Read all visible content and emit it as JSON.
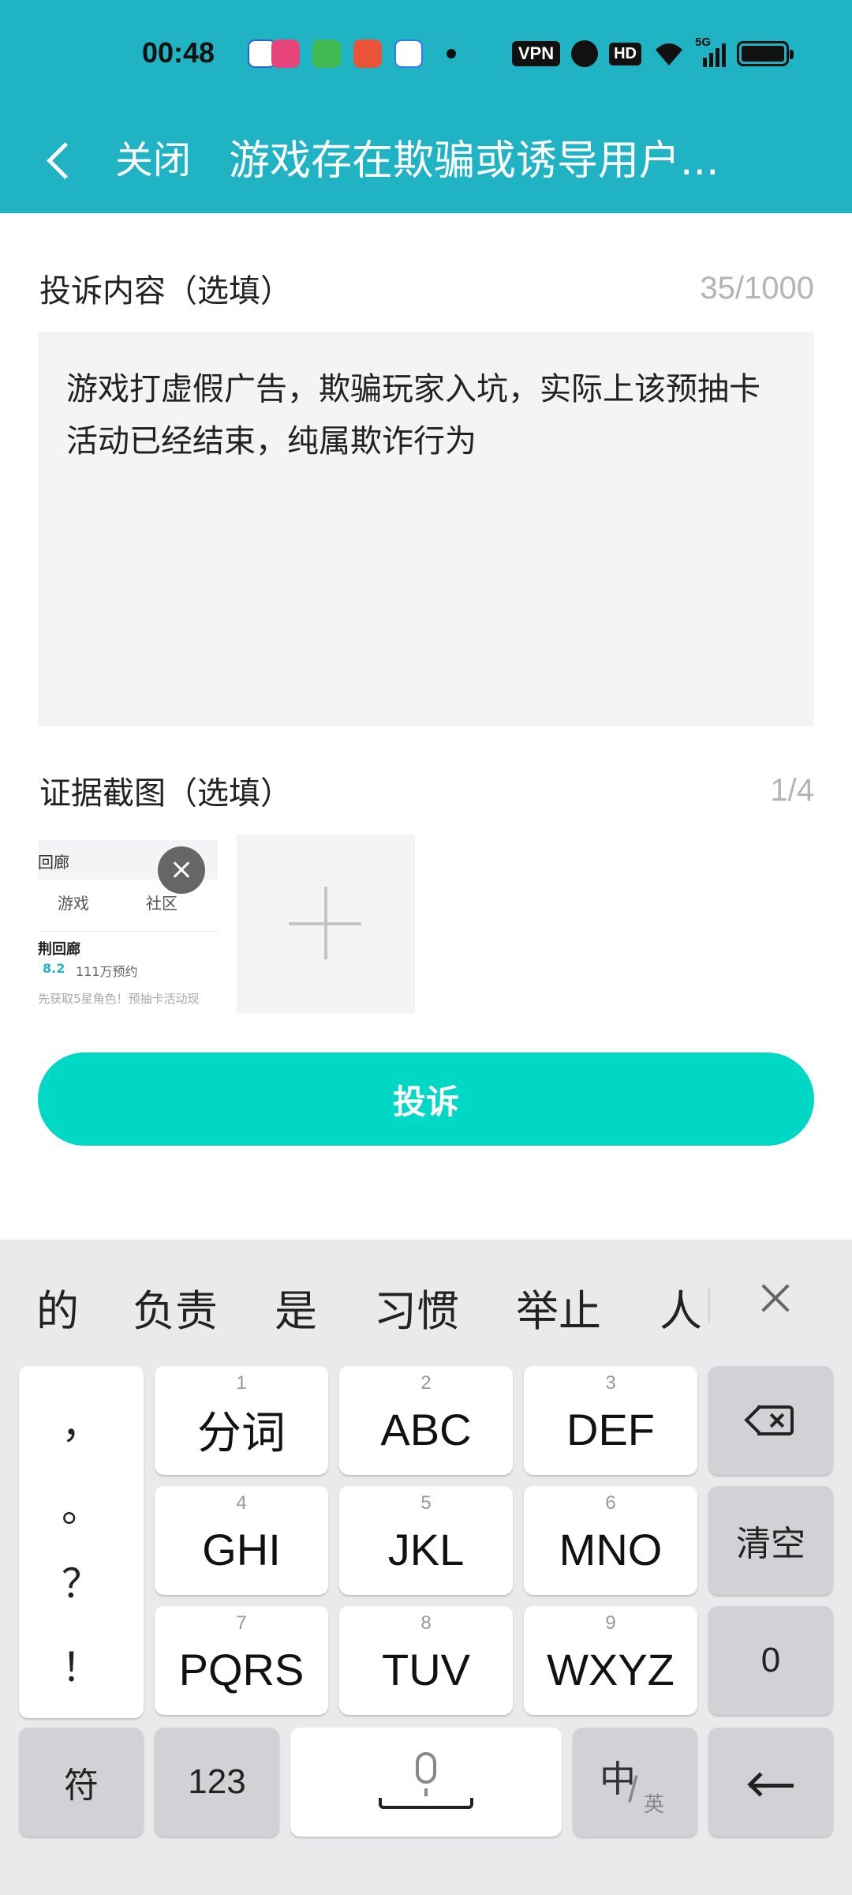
{
  "status_bar": {
    "time": "00:48",
    "indicators": [
      "VPN",
      "HD",
      "5G"
    ],
    "notification_icons": [
      "baidu-icon",
      "bilibili-icon",
      "messages-icon",
      "game-app-icon",
      "browser-icon"
    ]
  },
  "header": {
    "close_label": "关闭",
    "title": "游戏存在欺骗或诱导用户..."
  },
  "complaint": {
    "label": "投诉内容（选填）",
    "counter": "35/1000",
    "text": "游戏打虚假广告，欺骗玩家入坑，实际上该预抽卡活动已经结束，纯属欺诈行为"
  },
  "evidence": {
    "label": "证据截图（选填）",
    "counter": "1/4",
    "thumbnail": {
      "title_fragment": "回廊",
      "tab_game": "游戏",
      "tab_community": "社区",
      "app_name": "荆回廊",
      "rating": "8.2",
      "reservations": "111万预约",
      "description": "先获取5星角色！预抽卡活动现"
    }
  },
  "submit_label": "投诉",
  "keyboard": {
    "candidates": [
      "的",
      "负责",
      "是",
      "习惯",
      "举止",
      "人"
    ],
    "punctuation": [
      "，",
      "。",
      "？",
      "！"
    ],
    "keys": [
      {
        "num": "1",
        "label": "分词"
      },
      {
        "num": "2",
        "label": "ABC"
      },
      {
        "num": "3",
        "label": "DEF"
      },
      {
        "num": "4",
        "label": "GHI"
      },
      {
        "num": "5",
        "label": "JKL"
      },
      {
        "num": "6",
        "label": "MNO"
      },
      {
        "num": "7",
        "label": "PQRS"
      },
      {
        "num": "8",
        "label": "TUV"
      },
      {
        "num": "9",
        "label": "WXYZ"
      }
    ],
    "clear_label": "清空",
    "zero_label": "0",
    "symbol_label": "符",
    "numeric_label": "123",
    "lang_zh": "中",
    "lang_en": "英"
  },
  "colors": {
    "header_bg": "#1fb3c3",
    "submit_bg": "#00d8c6",
    "keyboard_bg": "#e9eaec"
  }
}
